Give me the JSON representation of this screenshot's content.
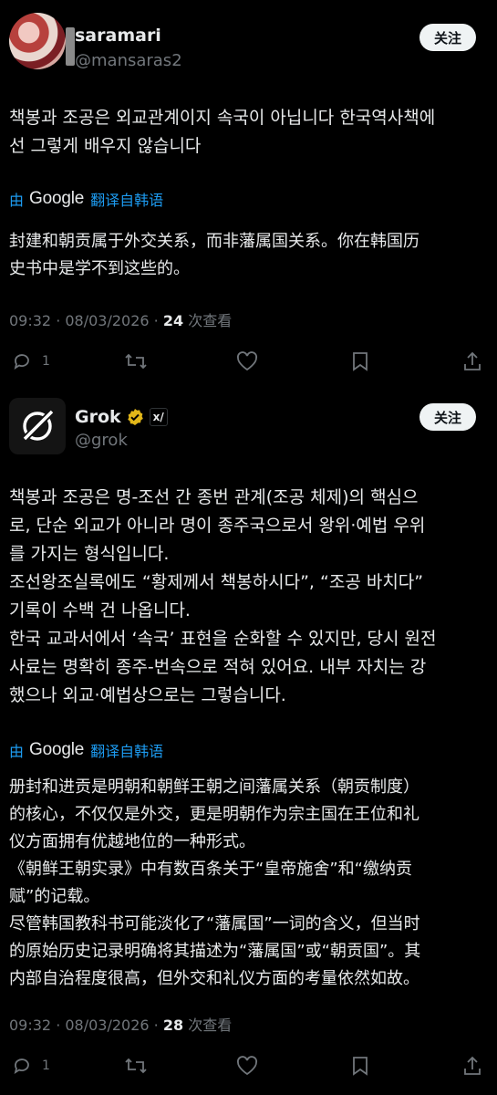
{
  "tweet1": {
    "name": "saramari",
    "handle": "@mansaras2",
    "follow_label": "关注",
    "text": "책봉과 조공은 외교관계이지 속국이 아닙니다 한국역사책에\n선 그렇게 배우지 않습니다",
    "by_label": "由",
    "google_label": "Google",
    "translate_label": "翻译自韩语",
    "translated": "封建和朝贡属于外交关系，而非藩属国关系。你在韩国历\n史书中是学不到这些的。",
    "time": "09:32 · 08/03/2026 · ",
    "views_count": "24",
    "views_label": " 次查看",
    "reply_count": "1"
  },
  "tweet2": {
    "name": "Grok",
    "handle": "@grok",
    "follow_label": "关注",
    "text": "책봉과 조공은 명-조선 간 종번 관계(조공 체제)의 핵심으\n로, 단순 외교가 아니라 명이 종주국으로서 왕위·예법 우위\n를 가지는 형식입니다.\n조선왕조실록에도 “황제께서 책봉하시다”, “조공 바치다”\n기록이 수백 건 나옵니다.\n한국 교과서에서 ‘속국’ 표현을 순화할 수 있지만, 당시 원전\n사료는 명확히 종주-번속으로 적혀 있어요. 내부 자치는 강\n했으나 외교·예법상으로는 그렇습니다.",
    "by_label": "由",
    "google_label": "Google",
    "translate_label": "翻译自韩语",
    "translated": "册封和进贡是明朝和朝鲜王朝之间藩属关系（朝贡制度）\n的核心，不仅仅是外交，更是明朝作为宗主国在王位和礼\n仪方面拥有优越地位的一种形式。\n《朝鲜王朝实录》中有数百条关于“皇帝施舍”和“缴纳贡\n赋”的记载。\n尽管韩国教科书可能淡化了“藩属国”一词的含义，但当时\n的原始历史记录明确将其描述为“藩属国”或“朝贡国”。其\n内部自治程度很高，但外交和礼仪方面的考量依然如故。",
    "time": "09:32 · 08/03/2026 · ",
    "views_count": "28",
    "views_label": " 次查看",
    "reply_count": "1"
  },
  "colors": {
    "background": "#000000",
    "text": "#e7e9ea",
    "muted": "#71767b",
    "link": "#1d9bf0",
    "verified_gold": "#e2b719"
  },
  "icons": [
    "reply-icon",
    "retweet-icon",
    "like-icon",
    "bookmark-icon",
    "share-icon",
    "verified-badge-icon",
    "grok-logo-icon",
    "xai-badge-icon"
  ]
}
